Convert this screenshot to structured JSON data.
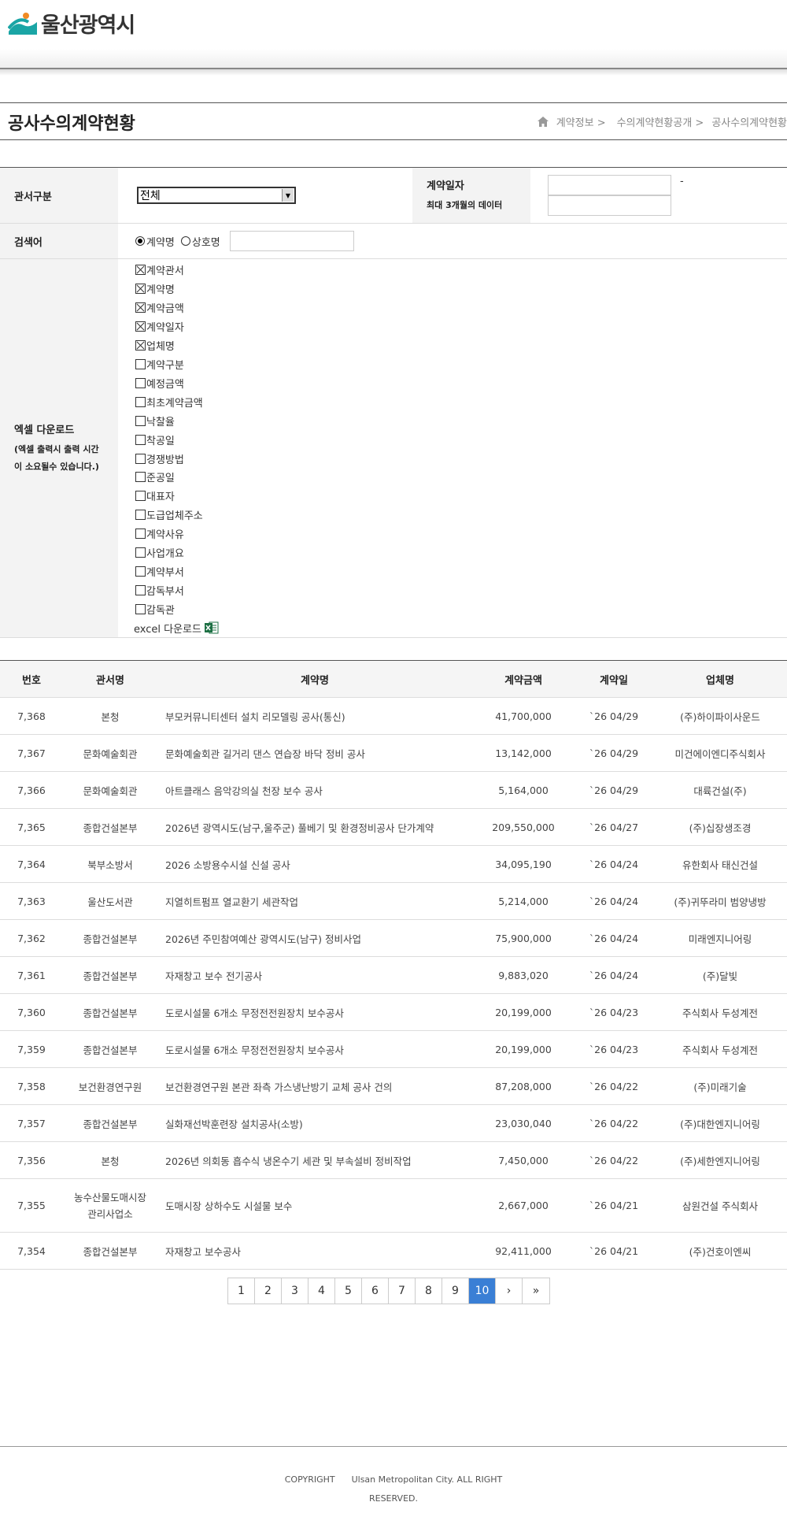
{
  "site": {
    "name": "울산광역시"
  },
  "page": {
    "title": "공사수의계약현황"
  },
  "breadcrumb": [
    "계약정보 >",
    "수의계약현황공개 >",
    "공사수의계약현황"
  ],
  "form": {
    "office_label": "관서구분",
    "office_value": "전체",
    "date_label": "계약일자",
    "date_sub": "최대 3개월의 데이터",
    "date_sep": "-",
    "search_label": "검색어",
    "radio_options": [
      {
        "label": "계약명",
        "checked": true
      },
      {
        "label": "상호명",
        "checked": false
      }
    ],
    "excel_label": "엑셀 다운로드",
    "excel_sub1": "(엑셀 출력시 출력 시간",
    "excel_sub2": "이 소요될수 있습니다.)",
    "checkboxes": [
      {
        "label": "계약관서",
        "checked": true
      },
      {
        "label": "계약명",
        "checked": true
      },
      {
        "label": "계약금액",
        "checked": true
      },
      {
        "label": "계약일자",
        "checked": true
      },
      {
        "label": "업체명",
        "checked": true
      },
      {
        "label": "계약구분",
        "checked": false
      },
      {
        "label": "예정금액",
        "checked": false
      },
      {
        "label": "최초계약금액",
        "checked": false
      },
      {
        "label": "낙찰율",
        "checked": false
      },
      {
        "label": "착공일",
        "checked": false
      },
      {
        "label": "경쟁방법",
        "checked": false
      },
      {
        "label": "준공일",
        "checked": false
      },
      {
        "label": "대표자",
        "checked": false
      },
      {
        "label": "도급업체주소",
        "checked": false
      },
      {
        "label": "계약사유",
        "checked": false
      },
      {
        "label": "사업개요",
        "checked": false
      },
      {
        "label": "계약부서",
        "checked": false
      },
      {
        "label": "감독부서",
        "checked": false
      },
      {
        "label": "감독관",
        "checked": false
      }
    ],
    "excel_link": "excel 다운로드"
  },
  "table": {
    "headers": [
      "번호",
      "관서명",
      "계약명",
      "계약금액",
      "계약일",
      "업체명"
    ],
    "rows": [
      [
        "7,368",
        "본청",
        "부모커뮤니티센터 설치 리모델링 공사(통신)",
        "41,700,000",
        "`26 04/29",
        "(주)하이파이사운드"
      ],
      [
        "7,367",
        "문화예술회관",
        "문화예술회관 길거리 댄스 연습장 바닥 정비 공사",
        "13,142,000",
        "`26 04/29",
        "미건에이엔디주식회사"
      ],
      [
        "7,366",
        "문화예술회관",
        "아트클래스 음악강의실 천장 보수 공사",
        "5,164,000",
        "`26 04/29",
        "대륙건설(주)"
      ],
      [
        "7,365",
        "종합건설본부",
        "2026년 광역시도(남구,울주군) 풀베기 및 환경정비공사 단가계약",
        "209,550,000",
        "`26 04/27",
        "(주)십장생조경"
      ],
      [
        "7,364",
        "북부소방서",
        "2026 소방용수시설 신설 공사",
        "34,095,190",
        "`26 04/24",
        "유한회사 태신건설"
      ],
      [
        "7,363",
        "울산도서관",
        "지열히트펌프 열교환기 세관작업",
        "5,214,000",
        "`26 04/24",
        "(주)귀뚜라미 범양냉방"
      ],
      [
        "7,362",
        "종합건설본부",
        "2026년 주민참여예산 광역시도(남구) 정비사업",
        "75,900,000",
        "`26 04/24",
        "미래엔지니어링"
      ],
      [
        "7,361",
        "종합건설본부",
        "자재창고 보수 전기공사",
        "9,883,020",
        "`26 04/24",
        "(주)달빛"
      ],
      [
        "7,360",
        "종합건설본부",
        "도로시설물 6개소 무정전전원장치 보수공사",
        "20,199,000",
        "`26 04/23",
        "주식회사 두성계전"
      ],
      [
        "7,359",
        "종합건설본부",
        "도로시설물 6개소 무정전전원장치 보수공사",
        "20,199,000",
        "`26 04/23",
        "주식회사 두성계전"
      ],
      [
        "7,358",
        "보건환경연구원",
        "보건환경연구원 본관 좌측 가스냉난방기 교체 공사 건의",
        "87,208,000",
        "`26 04/22",
        "(주)미래기술"
      ],
      [
        "7,357",
        "종합건설본부",
        "실화재선박훈련장 설치공사(소방)",
        "23,030,040",
        "`26 04/22",
        "(주)대한엔지니어링"
      ],
      [
        "7,356",
        "본청",
        "2026년 의회동 흡수식 냉온수기 세관 및 부속설비 정비작업",
        "7,450,000",
        "`26 04/22",
        "(주)세한엔지니어링"
      ],
      [
        "7,355",
        "농수산물도매시장 관리사업소",
        "도매시장 상하수도 시설물 보수",
        "2,667,000",
        "`26 04/21",
        "삼원건설 주식회사"
      ],
      [
        "7,354",
        "종합건설본부",
        "자재창고 보수공사",
        "92,411,000",
        "`26 04/21",
        "(주)건호이엔씨"
      ]
    ]
  },
  "pager": {
    "pages": [
      "1",
      "2",
      "3",
      "4",
      "5",
      "6",
      "7",
      "8",
      "9",
      "10"
    ],
    "active": "10",
    "next": "›",
    "last": "»"
  },
  "footer": {
    "copyright": "COPYRIGHT",
    "owner": "Ulsan Metropolitan City. ALL RIGHT RESERVED."
  },
  "colors": {
    "accent": "#3a7fd5",
    "logo_teal": "#1aa5a5",
    "logo_orange": "#f08a24"
  }
}
